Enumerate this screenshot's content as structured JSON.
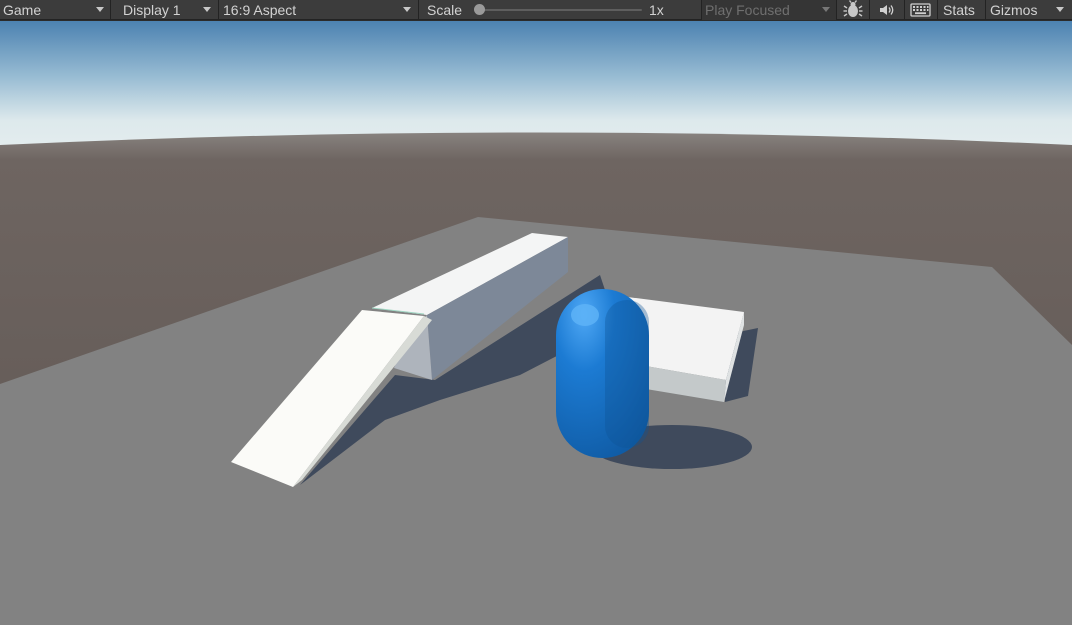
{
  "toolbar": {
    "view_tab": "Game",
    "display": "Display 1",
    "aspect": "16:9 Aspect",
    "scale_label": "Scale",
    "scale_value": "1x",
    "scale_slider_fraction": 0.0,
    "play_mode": "Play Focused",
    "stats": "Stats",
    "gizmos": "Gizmos"
  },
  "icons": {
    "bug": "bug-icon",
    "audio": "speaker-icon",
    "keyboard": "keyboard-icon",
    "dropdown": "chevron-down-icon"
  },
  "colors": {
    "toolbar_bg": "#3c3c3c",
    "toolbar_text": "#d2d2d2",
    "sky_top": "#4e83b2",
    "sky_horizon": "#d9e6ea",
    "ground_far": "#6e6561",
    "plane": "#828282",
    "capsule": "#1a74c9",
    "boxes": "#f2f3f3"
  }
}
